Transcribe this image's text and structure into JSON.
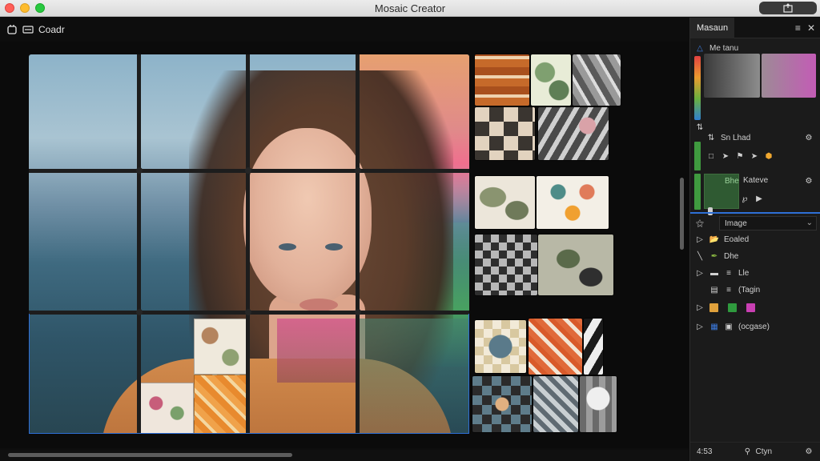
{
  "window": {
    "title": "Mosaic Creator"
  },
  "toolbar": {
    "label": "Coadr"
  },
  "panel": {
    "tab": "Masaun",
    "palette_label": "Me tanu",
    "section_2_label": "Sn Lhad",
    "layer_name": "Bhe",
    "layer_label": "Kateve",
    "dropdown_value": "Image",
    "list": [
      {
        "label": "Eoaled"
      },
      {
        "label": "Dhe"
      },
      {
        "label": "Lle"
      },
      {
        "label": "(Tagin"
      },
      {
        "label": ""
      },
      {
        "label": "(ocgase)"
      }
    ],
    "footer_zoom": "4:53",
    "footer_search": "Ctyn"
  },
  "colors": {
    "accent": "#2e6fd6",
    "swatch_orange": "#e0a13c",
    "swatch_green": "#2f9a3e",
    "swatch_magenta": "#c93fb3"
  }
}
